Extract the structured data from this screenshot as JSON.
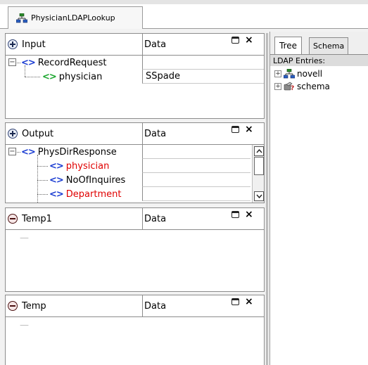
{
  "document_tab": {
    "label": "PhysicianLDAPLookup",
    "icon": "ldap-tree-icon"
  },
  "panels": {
    "input": {
      "title": "Input",
      "data_header": "Data",
      "rows": [
        {
          "name": "RecordRequest",
          "value": ""
        },
        {
          "name": "physician",
          "value": "SSpade"
        }
      ]
    },
    "output": {
      "title": "Output",
      "data_header": "Data",
      "rows": [
        {
          "name": "PhysDirResponse",
          "value": ""
        },
        {
          "name": "physician",
          "value": ""
        },
        {
          "name": "NoOfInquires",
          "value": ""
        },
        {
          "name": "Department",
          "value": ""
        }
      ]
    },
    "temp1": {
      "title": "Temp1",
      "data_header": "Data",
      "placeholder": "—"
    },
    "temp": {
      "title": "Temp",
      "data_header": "Data",
      "placeholder": "—"
    }
  },
  "right_panel": {
    "tabs": [
      "Tree",
      "Schema"
    ],
    "active_tab": "Tree",
    "section_label": "LDAP Entries:",
    "items": [
      {
        "label": "novell",
        "icon": "ldap-tree-icon"
      },
      {
        "label": "schema",
        "icon": "schema-icon"
      }
    ]
  },
  "colors": {
    "chevron_blue": "#1a3cd2",
    "chevron_green": "#1aa52d",
    "required_red": "#e00000"
  }
}
